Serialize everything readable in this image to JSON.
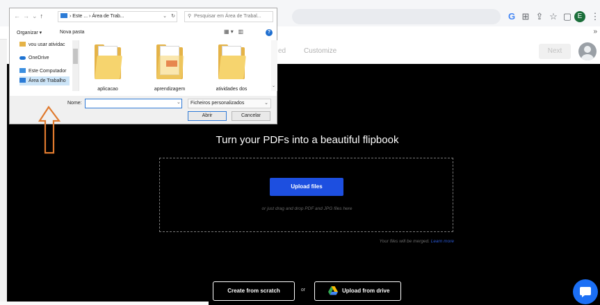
{
  "browser": {
    "icons": [
      "google-icon",
      "translate-icon",
      "share-icon",
      "star-icon",
      "sidebar-icon",
      "kebab-menu-icon"
    ],
    "profile_initial": "E",
    "bookmarks_more": "»"
  },
  "app": {
    "step_published": "ed",
    "step_customize": "Customize",
    "next_label": "Next",
    "heading": "Turn your PDFs into a beautiful flipbook",
    "upload_files_label": "Upload files",
    "drag_hint": "or just drag and drop PDF and JPG files here",
    "merge_note": "Your files will be merged.",
    "learn_more": "Learn more",
    "create_scratch_label": "Create from scratch",
    "or_label": "or",
    "upload_drive_label": "Upload from drive",
    "colors": {
      "accent": "#1d4fe0",
      "chat": "#1b6ff5",
      "background": "#000000"
    }
  },
  "dialog": {
    "path_seg1": "Este ...",
    "path_seg2": "Área de Trab...",
    "search_placeholder": "Pesquisar em Área de Trabal...",
    "organize_label": "Organizar ▾",
    "new_folder_label": "Nova pasta",
    "nav_items": [
      {
        "label": "vou usar atividac",
        "icon": "folder-icon"
      },
      {
        "label": "OneDrive",
        "icon": "onedrive-icon"
      },
      {
        "label": "Este Computador",
        "icon": "computer-icon"
      },
      {
        "label": "Área de Trabalho",
        "icon": "desktop-icon"
      }
    ],
    "files": [
      {
        "name": "aplicacao",
        "type": "folder"
      },
      {
        "name": "aprendizagem",
        "type": "pdf-folder"
      },
      {
        "name": "atividades dos",
        "type": "folder"
      }
    ],
    "name_label": "Nome:",
    "name_value": "",
    "filetype": "Ficheiros personalizados",
    "open_label": "Abrir",
    "cancel_label": "Cancelar"
  }
}
